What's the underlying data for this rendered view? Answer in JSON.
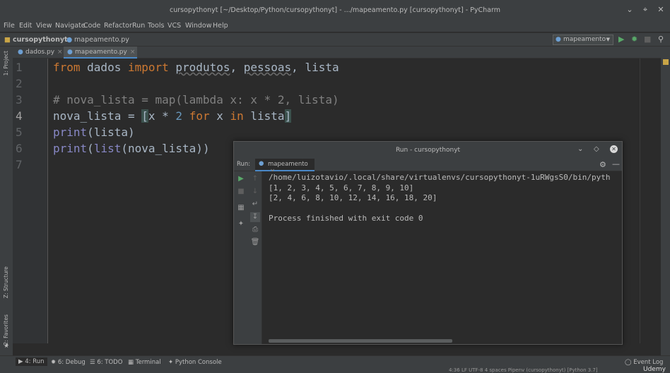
{
  "window": {
    "title": "cursopythonyt [~/Desktop/Python/cursopythonyt] - .../mapeamento.py [cursopythonyt] - PyCharm"
  },
  "menu": [
    "File",
    "Edit",
    "View",
    "Navigate",
    "Code",
    "Refactor",
    "Run",
    "Tools",
    "VCS",
    "Window",
    "Help"
  ],
  "breadcrumb": {
    "project": "cursopythonyt",
    "file": "mapeamento.py"
  },
  "run_config": {
    "name": "mapeamento"
  },
  "left_strip": {
    "project": "1: Project",
    "structure": "Z: Structure",
    "favorites": "2: Favorites"
  },
  "tabs": [
    {
      "label": "dados.py",
      "active": false
    },
    {
      "label": "mapeamento.py",
      "active": true
    }
  ],
  "editor": {
    "line_numbers": [
      "1",
      "2",
      "3",
      "4",
      "5",
      "6",
      "7"
    ],
    "current_line": "4",
    "lines": {
      "l1": {
        "from": "from",
        "mod": " dados ",
        "import": "import",
        "a": "produtos",
        "c1": ", ",
        "b": "pessoas",
        "rest": ", lista"
      },
      "l3": {
        "comment": "# nova_lista = map(lambda x: x * 2, lista)"
      },
      "l4": {
        "a": "nova_lista = ",
        "br": "[",
        "x1": "x * ",
        "n": "2",
        "sp": " ",
        "for": "for",
        "x2": " x ",
        "in": "in",
        "rest": " lista",
        "br2": "]"
      },
      "l5": {
        "fn": "print",
        "rest": "(lista)"
      },
      "l6": {
        "fn": "print",
        "p1": "(",
        "fn2": "list",
        "rest": "(nova_lista))"
      }
    }
  },
  "run_panel": {
    "title": "Run - cursopythonyt",
    "label": "Run:",
    "tab": "mapeamento",
    "output": [
      "/home/luizotavio/.local/share/virtualenvs/cursopythonyt-1uRWgsS0/bin/pyth",
      "[1, 2, 3, 4, 5, 6, 7, 8, 9, 10]",
      "[2, 4, 6, 8, 10, 12, 14, 16, 18, 20]",
      "",
      "Process finished with exit code 0"
    ]
  },
  "bottom_tools": [
    {
      "label": "4: Run",
      "active": true
    },
    {
      "label": "6: Debug",
      "active": false
    },
    {
      "label": "6: TODO",
      "active": false
    },
    {
      "label": "Terminal",
      "active": false
    },
    {
      "label": "Python Console",
      "active": false
    }
  ],
  "event_log": "Event Log",
  "watermark": "Udemy",
  "status": "4:36  LF  UTF-8  4 spaces  Pipenv (cursopythonyt) [Python 3.7]"
}
